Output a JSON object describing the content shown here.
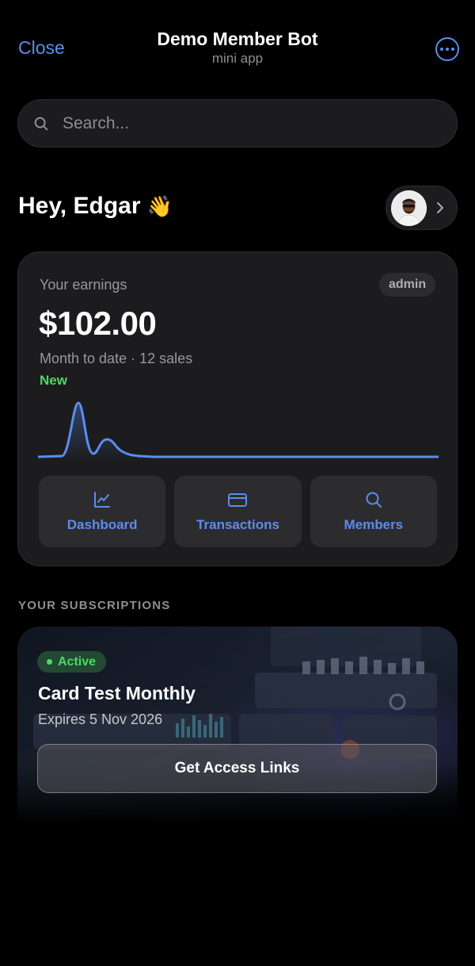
{
  "header": {
    "close_label": "Close",
    "title": "Demo Member Bot",
    "subtitle": "mini app",
    "more_icon": "more-horizontal-circle-icon",
    "accent": "#5b8def"
  },
  "search": {
    "placeholder": "Search...",
    "value": "",
    "icon": "search-icon"
  },
  "greeting": {
    "text": "Hey, Edgar",
    "emoji": "👋"
  },
  "profile": {
    "avatar_icon": "avatar",
    "chevron_icon": "chevron-right-icon"
  },
  "earnings": {
    "label": "Your earnings",
    "role_badge": "admin",
    "amount": "$102.00",
    "period": "Month to date · 12 sales",
    "tag": "New",
    "tag_color": "#4cd964",
    "line_color": "#5b8def"
  },
  "actions": [
    {
      "label": "Dashboard",
      "icon": "chart-icon"
    },
    {
      "label": "Transactions",
      "icon": "credit-card-icon"
    },
    {
      "label": "Members",
      "icon": "search-icon"
    }
  ],
  "subscriptions": {
    "section_title": "YOUR SUBSCRIPTIONS",
    "items": [
      {
        "status": "Active",
        "status_color": "#4cd964",
        "name": "Card Test Monthly",
        "expires": "Expires 5 Nov 2026",
        "button_label": "Get Access Links"
      }
    ]
  }
}
